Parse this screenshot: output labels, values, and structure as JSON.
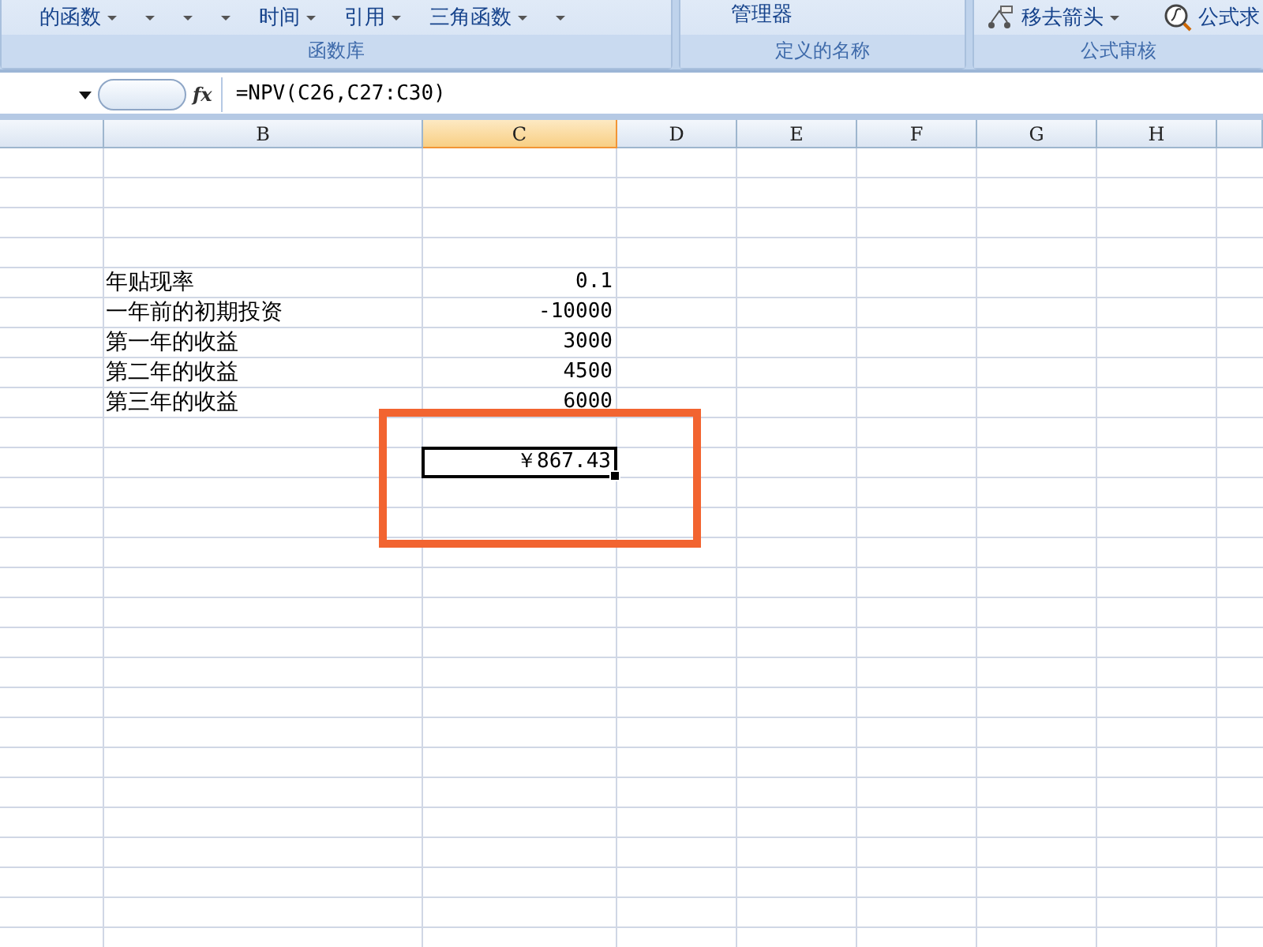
{
  "ribbon": {
    "groups": [
      {
        "label": "函数库",
        "items": [
          {
            "kind": "dropdown",
            "text": "的函数"
          },
          {
            "kind": "arrow"
          },
          {
            "kind": "arrow"
          },
          {
            "kind": "arrow"
          },
          {
            "kind": "dropdown",
            "text": "时间"
          },
          {
            "kind": "dropdown",
            "text": "引用"
          },
          {
            "kind": "dropdown",
            "text": "三角函数"
          },
          {
            "kind": "arrow"
          }
        ]
      },
      {
        "label": "定义的名称",
        "items": [
          {
            "kind": "plain",
            "text": "管理器"
          }
        ]
      },
      {
        "label": "公式审核",
        "items": [
          {
            "kind": "trace",
            "text": "移去箭头"
          },
          {
            "kind": "evaluate",
            "text": "公式求"
          }
        ]
      }
    ]
  },
  "formula_bar": {
    "function_symbol": "fx",
    "formula": "=NPV(C26,C27:C30)"
  },
  "columns": [
    {
      "label": "B",
      "selected": false
    },
    {
      "label": "C",
      "selected": true
    },
    {
      "label": "D",
      "selected": false
    },
    {
      "label": "E",
      "selected": false
    },
    {
      "label": "F",
      "selected": false
    },
    {
      "label": "G",
      "selected": false
    },
    {
      "label": "H",
      "selected": false
    }
  ],
  "rows": [
    {
      "label": "年贴现率",
      "value": "0.1"
    },
    {
      "label": "一年前的初期投资",
      "value": "-10000"
    },
    {
      "label": "第一年的收益",
      "value": "3000"
    },
    {
      "label": "第二年的收益",
      "value": "4500"
    },
    {
      "label": "第三年的收益",
      "value": "6000"
    }
  ],
  "result": {
    "value": "￥867.43",
    "selected": true
  }
}
